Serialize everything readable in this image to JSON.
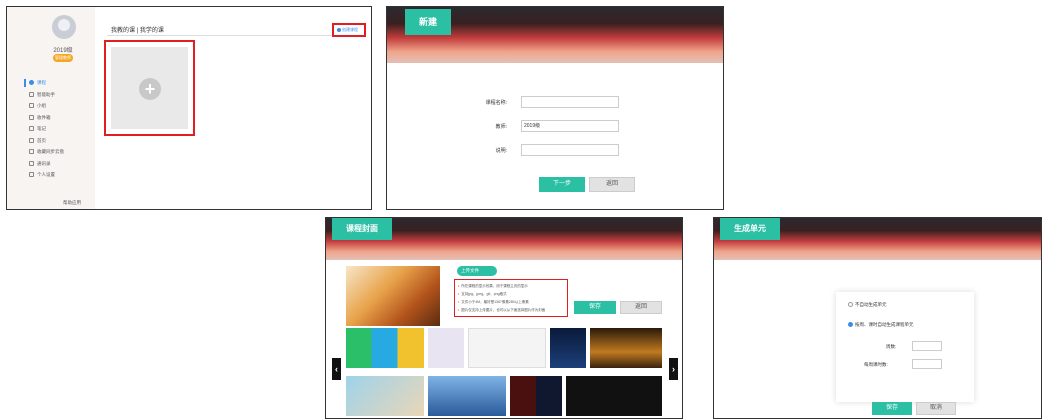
{
  "panel1": {
    "user": {
      "name": "2019级",
      "badge": "管理教师"
    },
    "menu": [
      {
        "label": "课程",
        "active": true
      },
      {
        "label": "智能助手",
        "active": false
      },
      {
        "label": "小组",
        "active": false
      },
      {
        "label": "收件箱",
        "active": false
      },
      {
        "label": "笔记",
        "active": false
      },
      {
        "label": "首页",
        "active": false
      },
      {
        "label": "收藏同步云盘",
        "active": false
      },
      {
        "label": "通讯录",
        "active": false
      },
      {
        "label": "个人设置",
        "active": false
      }
    ],
    "footer": "帮助应用",
    "tabs": "我教的课 | 我学的课",
    "add_course_link": "创建课程",
    "add_icon": "+"
  },
  "panel2": {
    "title": "新建",
    "fields": [
      {
        "label": "课程名称:",
        "value": ""
      },
      {
        "label": "教师:",
        "value": "2019级"
      },
      {
        "label": "说明:",
        "value": ""
      }
    ],
    "next": "下一步",
    "back": "返回"
  },
  "panel3": {
    "title": "课程封面",
    "upload": "上传文件",
    "tips": [
      "所在课程的显示效果，用于课程主页的显示",
      "支持jpg、jpeg、gif、png格式",
      "文件小于4M，最好是1367像素280以上像素",
      "图片仅支持上传图片，也可以从下面选择图片作为封面"
    ],
    "save": "保存",
    "back": "返回",
    "prev_icon": "‹",
    "next_icon": "›"
  },
  "panel4": {
    "title": "生成单元",
    "option1": "不自动生成单元",
    "option2": "按周、课时自动生成课程单元",
    "weeks_label": "周数:",
    "hours_label": "每周课时数:",
    "save": "保存",
    "cancel": "取消"
  },
  "colors": {
    "accent": "#2bbfa4",
    "highlight": "#e02020",
    "link": "#3a8ee6"
  }
}
